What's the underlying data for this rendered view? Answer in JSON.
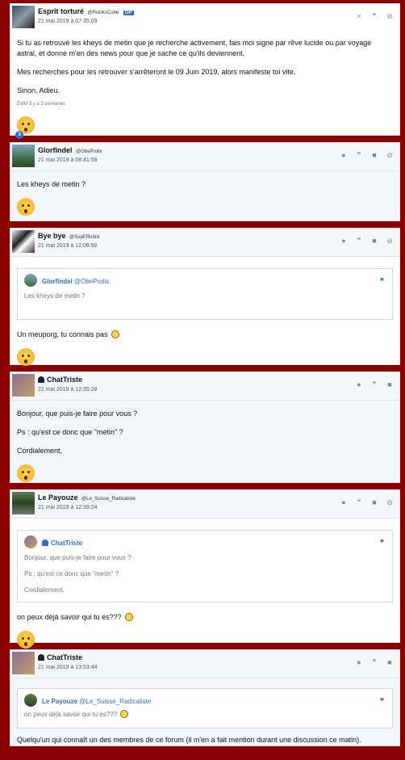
{
  "posts": [
    {
      "author": "Esprit torturé",
      "handle": "@RubiksCube",
      "op_label": "OP",
      "date": "21 mai 2019 à 07:35:09",
      "paragraphs": [
        "Si tu as retrouvé les kheys de metin que je recherche activement, fais moi signe par rêve lucide ou par voyage astral, et donne m'en des news pour que je sache ce qu'ils deviennent.",
        "Mes recherches pour les retrouver s'arrêteront le 09 Juin 2019, alors manifeste toi vite.",
        "Sinon, Adieu."
      ],
      "edited": "Edité il y a 3 semaines",
      "reaction_count": "3"
    },
    {
      "author": "Glorfindel",
      "handle": "@ObeProlix",
      "date": "21 mai 2019 à 08:41:56",
      "paragraphs": [
        "Les kheys de metin ?"
      ]
    },
    {
      "author": "Bye bye",
      "handle": "@SupERn3rd",
      "date": "21 mai 2019 à 12:06:50",
      "quote": {
        "author": "Glorfindel",
        "handle": "@ObeProlix",
        "paragraphs": [
          "Les kheys de metin ?"
        ]
      },
      "paragraphs": [
        "Un meuporg, tu connais pas"
      ]
    },
    {
      "author": "ChatTriste",
      "date": "21 mai 2019 à 12:35:28",
      "paragraphs": [
        "Bonjour, que puis-je faire pour vous ?",
        "Ps : qu'est ce donc que \"metin\" ?",
        "Cordialement,"
      ]
    },
    {
      "author": "Le Payouze",
      "handle": "@Le_Suisse_Radicaliste",
      "date": "21 mai 2019 à 12:39:24",
      "quote": {
        "author": "ChatTriste",
        "paragraphs": [
          "Bonjour, que puis-je faire pour vous ?",
          "Ps : qu'est ce donc que \"metin\" ?",
          "Cordialement,"
        ]
      },
      "paragraphs": [
        "on peux déjà savoir qui tu es???"
      ]
    },
    {
      "author": "ChatTriste",
      "date": "21 mai 2019 à 13:53:44",
      "quote": {
        "author": "Le Payouze",
        "handle": "@Le_Suisse_Radicaliste",
        "paragraphs": [
          "on peux déjà savoir qui tu es???"
        ]
      },
      "paragraphs": [
        "Quelqu'un qui connaît un des membres de ce forum (il m'en a fait mention durant une discussion ce matin)."
      ]
    }
  ],
  "icons": {
    "close": "×",
    "quote": "❞",
    "comment": "●",
    "flag": "■",
    "block": "⊘"
  }
}
